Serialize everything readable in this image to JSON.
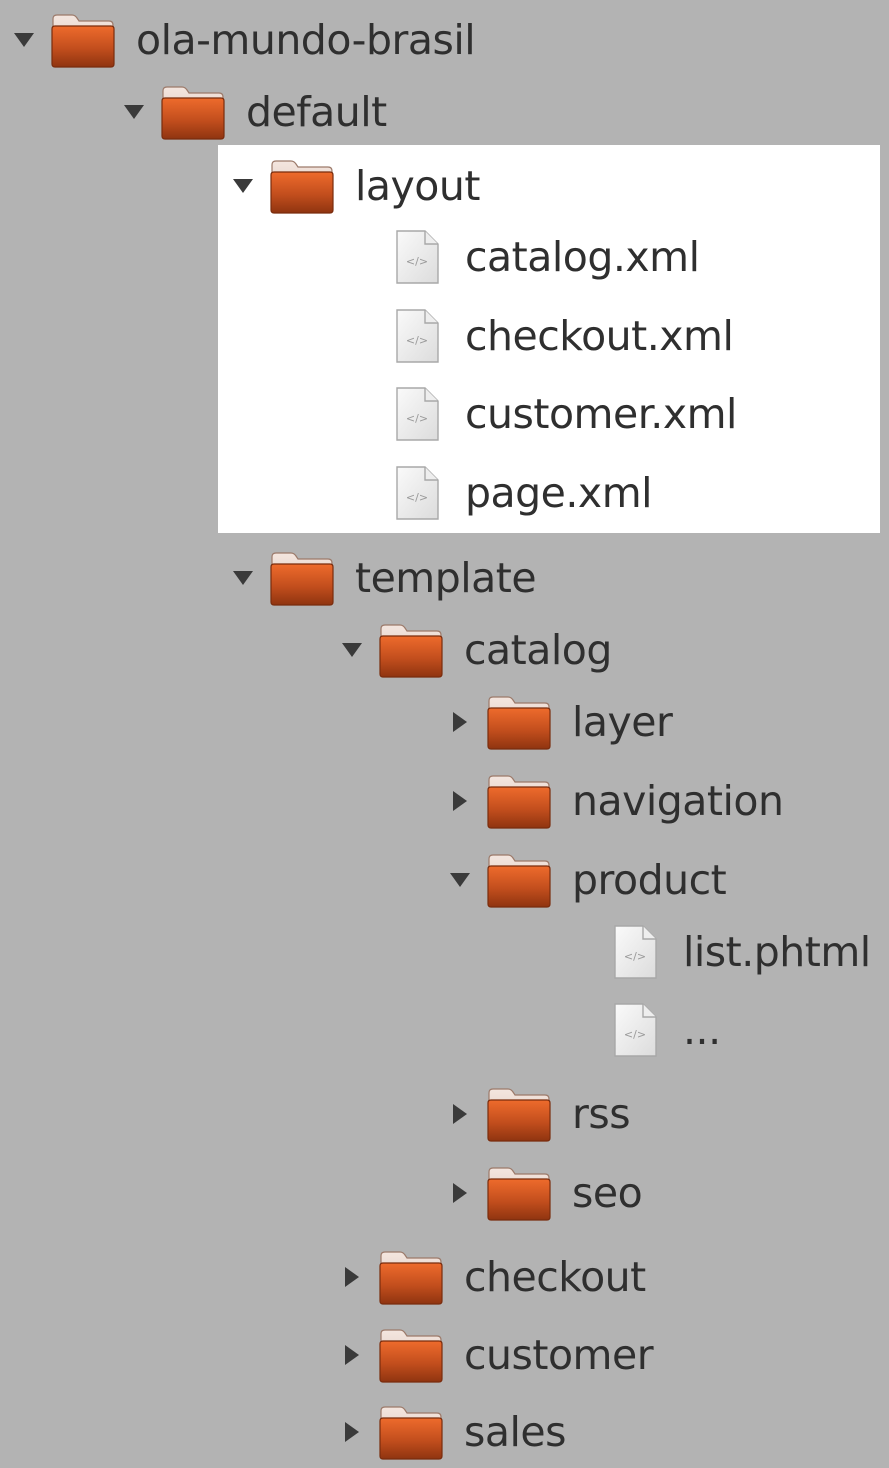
{
  "tree": {
    "root": {
      "label": "ola-mundo-brasil",
      "expanded": true
    },
    "default": {
      "label": "default",
      "expanded": true
    },
    "layout": {
      "label": "layout",
      "expanded": true,
      "files": [
        "catalog.xml",
        "checkout.xml",
        "customer.xml",
        "page.xml"
      ]
    },
    "template": {
      "label": "template",
      "expanded": true
    },
    "catalog": {
      "label": "catalog",
      "expanded": true
    },
    "layer": {
      "label": "layer",
      "expanded": false
    },
    "navigation": {
      "label": "navigation",
      "expanded": false
    },
    "product": {
      "label": "product",
      "expanded": true,
      "files": [
        "list.phtml",
        "..."
      ]
    },
    "rss": {
      "label": "rss",
      "expanded": false
    },
    "seo": {
      "label": "seo",
      "expanded": false
    },
    "checkout": {
      "label": "checkout",
      "expanded": false
    },
    "customer": {
      "label": "customer",
      "expanded": false
    },
    "sales": {
      "label": "sales",
      "expanded": false
    }
  },
  "colors": {
    "background": "#b3b3b3",
    "selection": "#ffffff",
    "folder": "#c8521e",
    "text": "#2f2f2f"
  },
  "icons": {
    "folder": "folder-icon",
    "file": "code-file-icon",
    "expanded": "triangle-down-icon",
    "collapsed": "triangle-right-icon"
  }
}
